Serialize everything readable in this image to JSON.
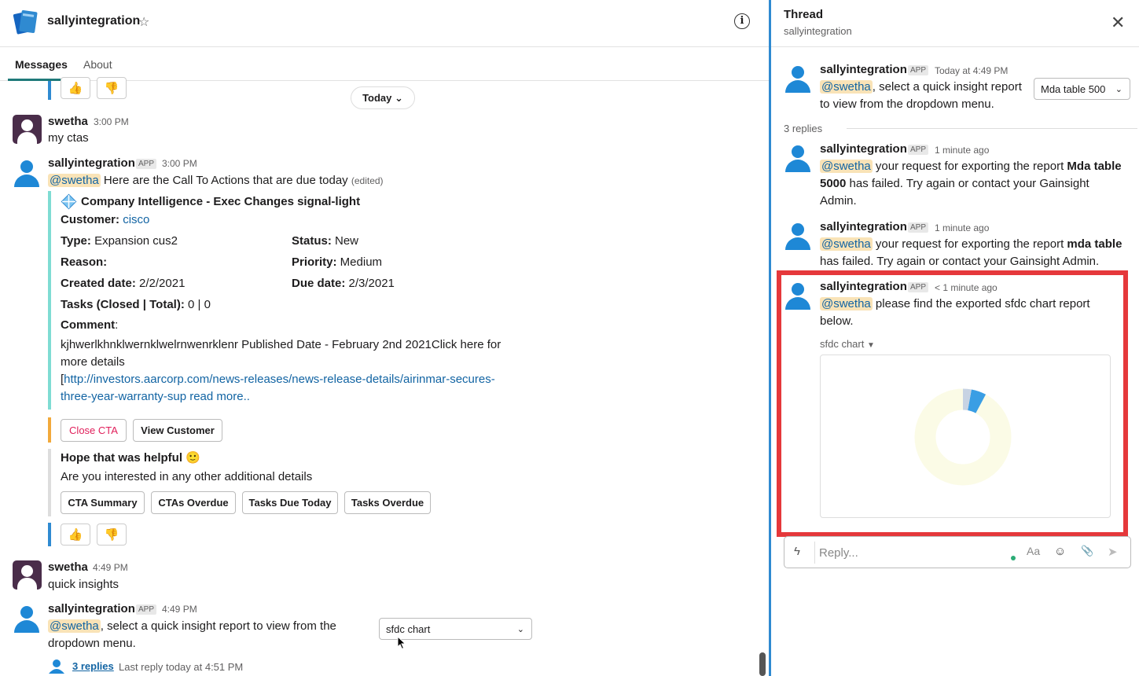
{
  "channel": {
    "name": "sallyintegration",
    "tabs": [
      "Messages",
      "About"
    ]
  },
  "date_divider": "Today",
  "icons": {
    "star": "☆",
    "info": "i",
    "thumbs_up": "👍",
    "thumbs_down": "👎",
    "smile": "🙂",
    "close": "✕",
    "chevron": "⌄",
    "bolt": "ϟ",
    "format": "Aa",
    "emoji": "☺",
    "attach": "📎",
    "send": "➤"
  },
  "messages": [
    {
      "author": "swetha",
      "time": "3:00 PM",
      "text": "my ctas"
    },
    {
      "author": "sallyintegration",
      "badge": "APP",
      "time": "3:00 PM",
      "mention": "@swetha",
      "text": " Here are the Call To Actions that are due today ",
      "edited": "(edited)",
      "card": {
        "title": "Company Intelligence - Exec Changes signal-light",
        "customer_label": "Customer:",
        "customer_value": "cisco",
        "type_label": "Type:",
        "type_value": " Expansion cus2",
        "status_label": "Status:",
        "status_value": " New",
        "reason_label": "Reason:",
        "priority_label": "Priority:",
        "priority_value": " Medium",
        "created_label": "Created date:",
        "created_value": " 2/2/2021",
        "due_label": "Due date:",
        "due_value": " 2/3/2021",
        "tasks_label": "Tasks (Closed | Total):",
        "tasks_value": " 0 | 0",
        "comment_label": "Comment",
        "comment_text_1": "kjhwerlkhnklwernklwelrnwenrklenr Published Date - February 2nd 2021Click here for",
        "comment_text_2": "more details",
        "comment_link_1": "http://investors.aarcorp.com/news-releases/news-release-details/airinmar-secures-",
        "comment_link_2": "three-year-warranty-sup read more.."
      },
      "actions": [
        "Close CTA",
        "View Customer"
      ],
      "helpful_title": "Hope that was helpful",
      "helpful_sub": "Are you interested in any other additional details",
      "quick_buttons": [
        "CTA Summary",
        "CTAs Overdue",
        "Tasks Due Today",
        "Tasks Overdue"
      ]
    },
    {
      "author": "swetha",
      "time": "4:49 PM",
      "text": "quick insights"
    },
    {
      "author": "sallyintegration",
      "badge": "APP",
      "time": "4:49 PM",
      "mention": "@swetha",
      "text_1": ", select a quick insight report to view from the",
      "text_2": "dropdown menu.",
      "select_value": "sfdc chart",
      "replies_link": "3 replies",
      "last_reply": "Last reply today at 4:51 PM"
    }
  ],
  "thread": {
    "title": "Thread",
    "subtitle": "sallyintegration",
    "parent": {
      "author": "sallyintegration",
      "badge": "APP",
      "time": "Today at 4:49 PM",
      "mention": "@swetha",
      "text_1": ", select a quick insight report",
      "text_2": "to view from the dropdown menu.",
      "select_value": "Mda table 500"
    },
    "replies_count": "3 replies",
    "replies": [
      {
        "author": "sallyintegration",
        "badge": "APP",
        "time": "1 minute ago",
        "mention": "@swetha",
        "text_a": " your request for exporting the report ",
        "bold_a": "Mda table",
        "bold_b": "5000",
        "text_b": " has failed. Try again or contact your Gainsight",
        "text_c": "Admin."
      },
      {
        "author": "sallyintegration",
        "badge": "APP",
        "time": "1 minute ago",
        "mention": "@swetha",
        "text_a": " your request for exporting the report ",
        "bold_a": "mda table",
        "text_b": "has failed. Try again or contact your Gainsight Admin."
      },
      {
        "author": "sallyintegration",
        "badge": "APP",
        "time": "< 1 minute ago",
        "mention": "@swetha",
        "text_a": " please find the exported sfdc chart report",
        "text_b": "below.",
        "attachment_name": "sfdc chart"
      }
    ],
    "reply_placeholder": "Reply..."
  },
  "chart_data": {
    "type": "pie",
    "donut": true,
    "slices": [
      {
        "value": 92,
        "color": "#fbfbe6"
      },
      {
        "value": 5,
        "color": "#3a9ee4"
      },
      {
        "value": 3,
        "color": "#c7d3e3"
      }
    ]
  }
}
